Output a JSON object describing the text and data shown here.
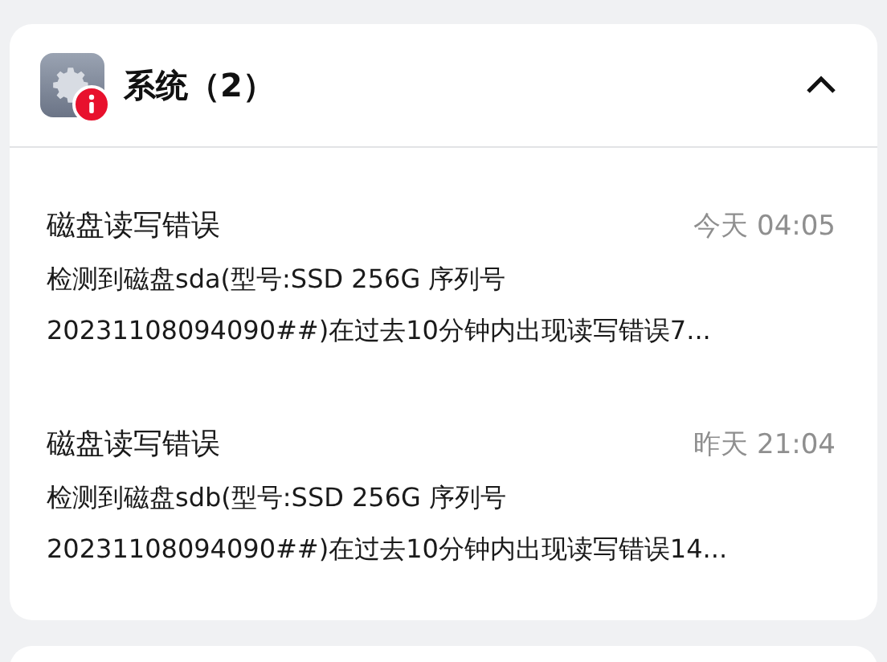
{
  "panel": {
    "title": "系统（2）",
    "expanded": true
  },
  "notifications": [
    {
      "title": "磁盘读写错误",
      "time": "今天 04:05",
      "description": "检测到磁盘sda(型号:SSD 256G 序列号 20231108094090##)在过去10分钟内出现读写错误7..."
    },
    {
      "title": "磁盘读写错误",
      "time": "昨天 21:04",
      "description": "检测到磁盘sdb(型号:SSD 256G 序列号 20231108094090##)在过去10分钟内出现读写错误14..."
    }
  ]
}
